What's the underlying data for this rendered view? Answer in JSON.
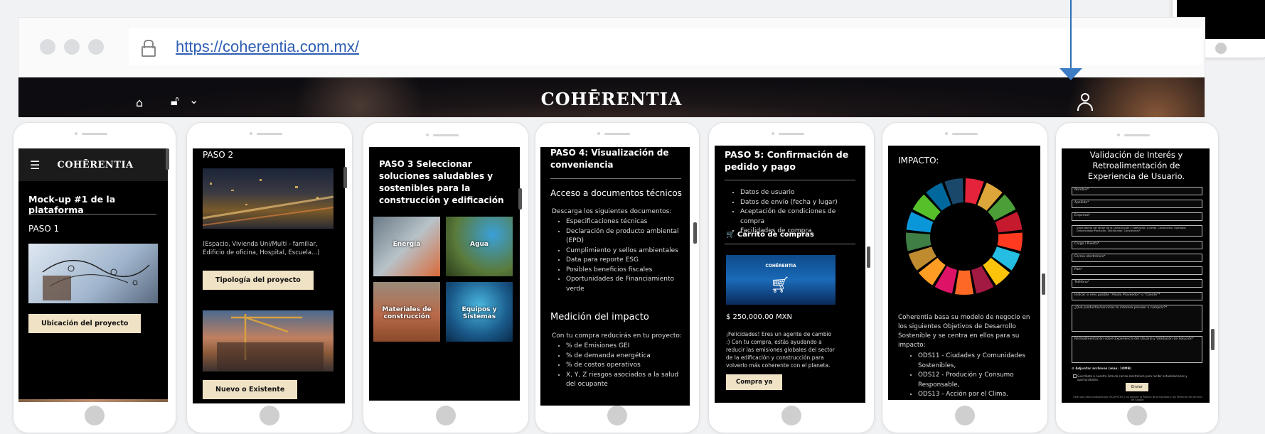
{
  "browser": {
    "url": "https://coherentia.com.mx/",
    "site_logo": "COHĒRENTIA"
  },
  "phones": {
    "p1": {
      "logo": "COHĒRENTIA",
      "title": "Mock-up #1 de la plataforma",
      "step": "PASO 1",
      "button": "Ubicación del proyecto"
    },
    "p2": {
      "step": "PASO 2",
      "caption": "(Espacio, Vivienda Uni/Multi - familiar, Edificio de oficina, Hospital, Escuela...)",
      "button1": "Tipología del proyecto",
      "button2": "Nuevo o Existente"
    },
    "p3": {
      "title": "PASO 3 Seleccionar soluciones saludables y sostenibles para la construcción y edificación",
      "tiles": [
        "Energía",
        "Agua",
        "Materiales de construcción",
        "Equipos y Sistemas"
      ]
    },
    "p4": {
      "title": "PASO 4: Visualización de conveniencia",
      "section1": "Acceso a documentos técnicos",
      "intro1": "Descarga los siguientes documentos:",
      "docs": [
        "Especificaciones técnicas",
        "Declaración de producto ambiental (EPD)",
        "Cumplimiento y sellos ambientales",
        "Data para reporte ESG",
        "Posibles beneficios fiscales",
        "Oportunidades de Financiamiento verde"
      ],
      "section2": "Medición del impacto",
      "intro2": "Con tu compra reducirás en tu proyecto:",
      "impacts": [
        "% de Emisiones GEI",
        "% de demanda energética",
        "% de costos operativos",
        "X, Y, Z riesgos asociados a la salud del ocupante"
      ]
    },
    "p5": {
      "title": "PASO 5: Confirmación de pedido y pago",
      "items": [
        "Datos de usuario",
        "Datos de envío (fecha y lugar)",
        "Aceptación de condiciones de compra",
        "Facilidades de compra"
      ],
      "cart": "🛒 Carrito de compras",
      "image_logo": "COHĒRENTIA",
      "price": "$ 250,000.00 MXN",
      "message": "¡Felicidades! Eres un agente de cambio :) Con tu compra, estás ayudando a reducir las emisiones globales del sector de la edificación y construcción para volverlo más coherente con el planeta.",
      "button": "Compra ya"
    },
    "p6": {
      "title": "IMPACTO:",
      "text": "Coherentia basa su modelo de negocio en los siguientes Objetivos de Desarrollo Sostenible y se centra en ellos para su impacto:",
      "goals": [
        "ODS11 - Ciudades y Comunidades Sostenibles,",
        "ODS12 - Produción y Consumo Responsable,",
        "ODS13 - Acción por el Clima."
      ]
    },
    "p7": {
      "title": "Validación de Interés y Retroalimentación de Experiencia de Usuario.",
      "fields": [
        "Nombre*",
        "Apellido*",
        "Empresa*",
        "Sub/s dentro del sector de la Construcción y Edificación (Cliente, Constructor, Operador, Desarrollador/Productor, Distribuidor, Consultoría)*",
        "Cargo / Puesto*",
        "Correo electrónico*",
        "País*",
        "Teléfono*",
        "Indicar si eres posible \"Aliado Proveedor\" o \"Cliente\"*"
      ],
      "textarea1": "¿Qué productos/servicios te interesa proveer o comprar?*",
      "textarea2": "Retroalimentación sobre Experiencia del Usuario y Validación de Solución*",
      "attach": "⊘ Adjuntar archivos (max. 10MB)",
      "checkbox": "Suscríbete a nuestra lista de correo electrónico para recibir actualizaciones y oportunidades.",
      "submit": "Enviar",
      "footer": "Este sitio está protegido por reCAPTCHA y se aplican la Política de privacidad y las Términos de servicio de Google."
    }
  },
  "colors": {
    "accent": "#2f6fb3",
    "beige": "#f0e2c5",
    "sdg": [
      "#e5243b",
      "#dda63a",
      "#4c9f38",
      "#c5192d",
      "#ff3a21",
      "#26bde2",
      "#fcc30b",
      "#a21942",
      "#fd6925",
      "#dd1367",
      "#fd9d24",
      "#bf8b2e",
      "#3f7e44",
      "#0a97d9",
      "#56c02b",
      "#00689d",
      "#19486a"
    ]
  }
}
